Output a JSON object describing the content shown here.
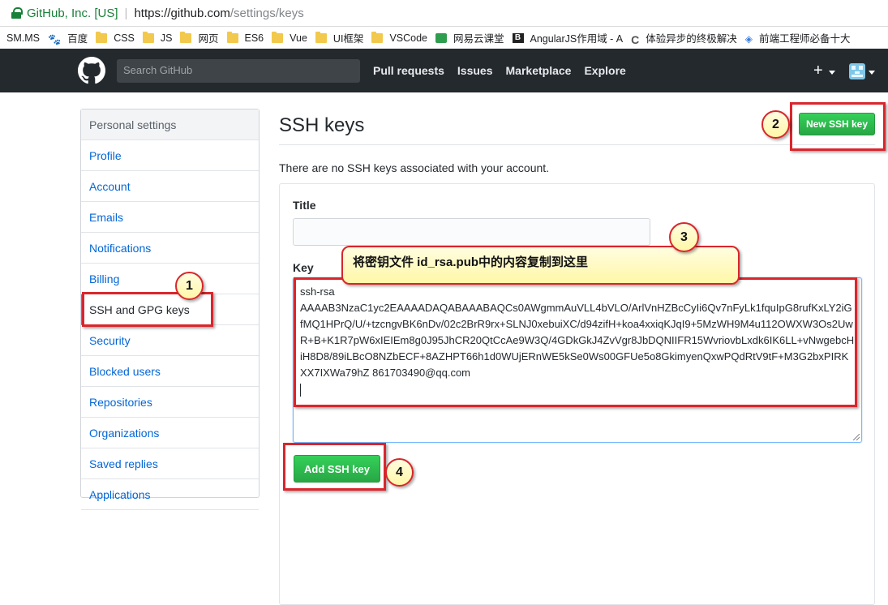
{
  "browser": {
    "org": "GitHub, Inc. [US]",
    "url_host": "https://github.com",
    "url_path": "/settings/keys"
  },
  "bookmarks": [
    {
      "label": "SM.MS",
      "icon": "none"
    },
    {
      "label": "百度",
      "icon": "baidu-paw-icon"
    },
    {
      "label": "CSS",
      "icon": "folder-icon"
    },
    {
      "label": "JS",
      "icon": "folder-icon"
    },
    {
      "label": "网页",
      "icon": "folder-icon"
    },
    {
      "label": "ES6",
      "icon": "folder-icon"
    },
    {
      "label": "Vue",
      "icon": "folder-icon"
    },
    {
      "label": "UI框架",
      "icon": "folder-icon"
    },
    {
      "label": "VSCode",
      "icon": "folder-icon"
    },
    {
      "label": "网易云课堂",
      "icon": "green-square-icon"
    },
    {
      "label": "AngularJS作用域 - A",
      "icon": "b-icon"
    },
    {
      "label": "体验异步的终极解决",
      "icon": "c-icon"
    },
    {
      "label": "前端工程师必备十大",
      "icon": "v-icon"
    }
  ],
  "header": {
    "search_placeholder": "Search GitHub",
    "nav": [
      "Pull requests",
      "Issues",
      "Marketplace",
      "Explore"
    ],
    "plus": "+"
  },
  "sidebar": {
    "heading": "Personal settings",
    "items": [
      {
        "label": "Profile"
      },
      {
        "label": "Account"
      },
      {
        "label": "Emails"
      },
      {
        "label": "Notifications"
      },
      {
        "label": "Billing"
      },
      {
        "label": "SSH and GPG keys",
        "selected": true
      },
      {
        "label": "Security"
      },
      {
        "label": "Blocked users"
      },
      {
        "label": "Repositories"
      },
      {
        "label": "Organizations"
      },
      {
        "label": "Saved replies"
      },
      {
        "label": "Applications"
      }
    ]
  },
  "main": {
    "title": "SSH keys",
    "new_key_button": "New SSH key",
    "no_keys_text": "There are no SSH keys associated with your account.",
    "title_label": "Title",
    "title_value": "",
    "key_label": "Key",
    "key_value": "ssh-rsa\nAAAAB3NzaC1yc2EAAAADAQABAAABAQCs0AWgmmAuVLL4bVLO/ArlVnHZBcCyIi6Qv7nFyLk1fquIpG8rufKxLY2iGfMQ1HPrQ/U/+tzcngvBK6nDv/02c2BrR9rx+SLNJ0xebuiXC/d94zifH+koa4xxiqKJqI9+5MzWH9M4u112OWXW3Os2UwR+B+K1R7pW6xIEIEm8g0J95JhCR20QtCcAe9W3Q/4GDkGkJ4ZvVgr8JbDQNIIFR15WvriovbLxdk6IK6LL+vNwgebcHiH8D8/89iLBcO8NZbECF+8AZHPT66h1d0WUjERnWE5kSe0Ws00GFUe5o8GkimyenQxwPQdRtV9tF+M3G2bxPIRKXX7IXWa79hZ 861703490@qq.com",
    "add_key_button": "Add SSH key"
  },
  "annotations": {
    "step1": "1",
    "step2": "2",
    "step3": "3",
    "step4": "4",
    "tip": "将密钥文件 id_rsa.pub中的内容复制到这里"
  },
  "colors": {
    "accent_red": "#d9262c",
    "github_green": "#28a745",
    "link_blue": "#0366d6",
    "header_bg": "#24292e"
  }
}
